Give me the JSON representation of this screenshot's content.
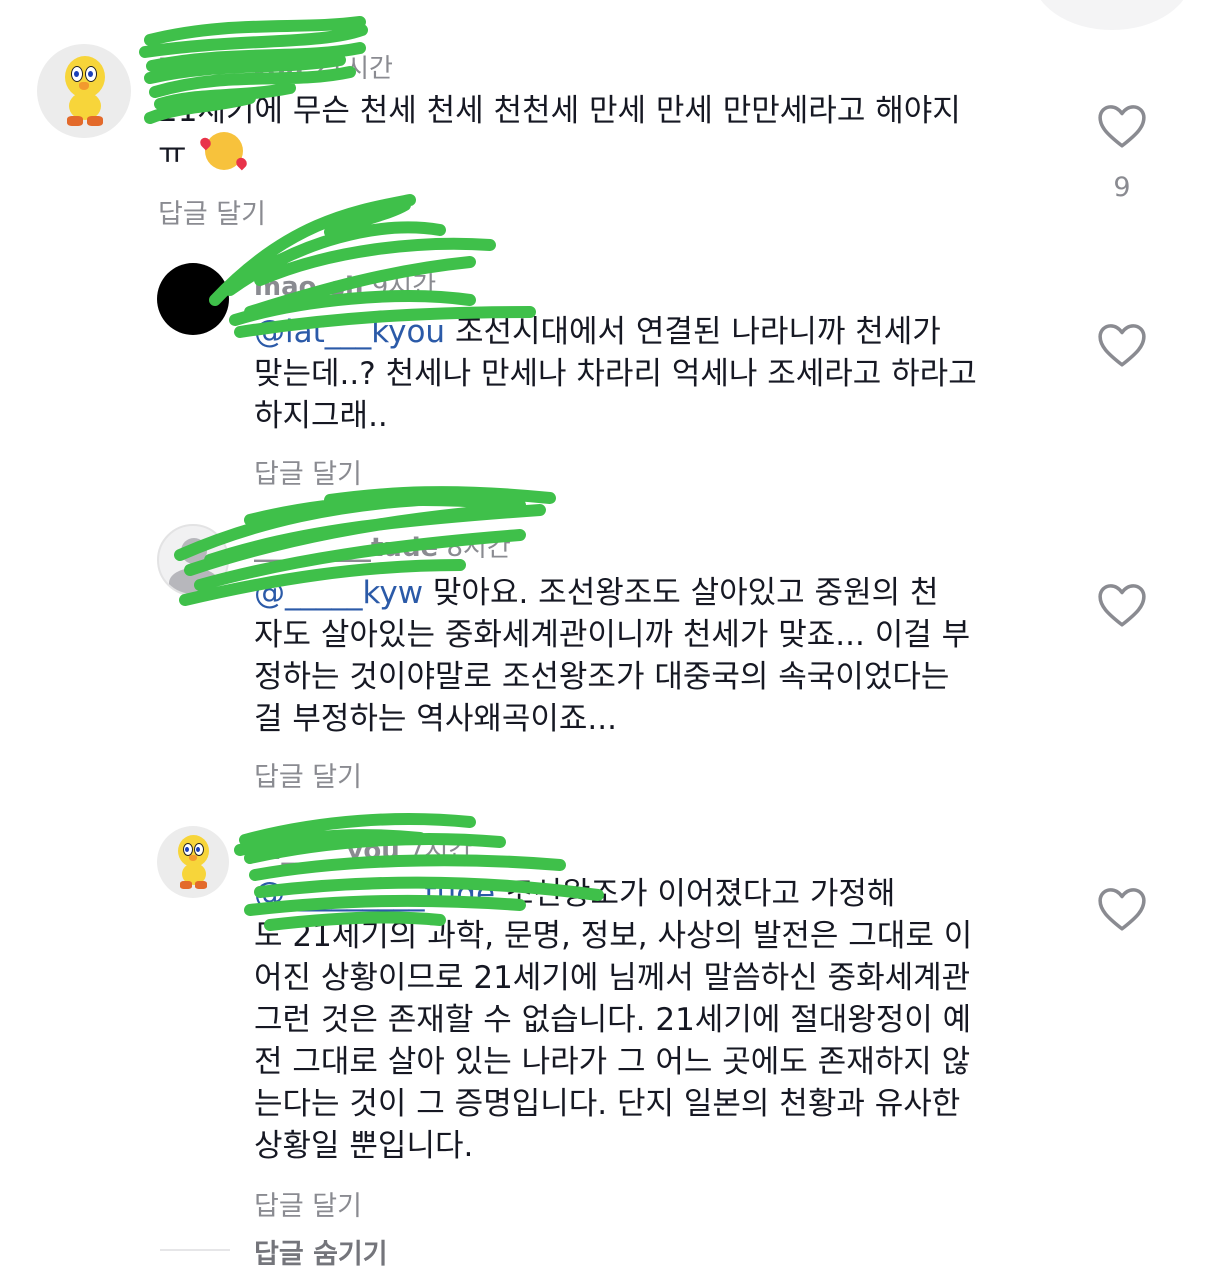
{
  "comments": [
    {
      "username": "iu_____you",
      "time": "21시간",
      "lines": [
        "21세기에 무슨 천세 천세 천천세 만세 만세 만만세라고 해야지",
        "ㅠ"
      ],
      "emoji": "smiling-face-with-hearts",
      "reply_label": "답글 달기",
      "like_count": "9"
    },
    {
      "username": "mao_sh",
      "time": "9시간",
      "mention": "@iat___kyou",
      "lines": [
        "조선시대에서 연결된 나라니까 천세가",
        "맞는데..? 천세나 만세나 차라리 억세나 조세라고 하라고",
        "하지그래.."
      ],
      "reply_label": "답글 달기"
    },
    {
      "username": "_________tude",
      "time": "8시간",
      "mention": "@_____kyw",
      "lines": [
        "맞아요. 조선왕조도 살아있고 중원의 천",
        "자도 살아있는 중화세계관이니까 천세가 맞죠... 이걸 부",
        "정하는 것이야말로 조선왕조가 대중국의 속국이었다는",
        "걸 부정하는 역사왜곡이죠..."
      ],
      "reply_label": "답글 달기"
    },
    {
      "username": "iu_____you",
      "time": "7시간",
      "mention": "@_________tude",
      "lines": [
        "조선왕조가 이어졌다고 가정해",
        "도 21세기의 과학, 문명, 정보, 사상의 발전은 그대로 이",
        "어진 상황이므로 21세기에 님께서 말씀하신 중화세계관",
        "그런 것은 존재할 수 없습니다. 21세기에 절대왕정이 예",
        "전 그대로 살아 있는 나라가 그 어느 곳에도 존재하지 않",
        "는다는 것이 그 증명입니다. 단지 일본의 천황과 유사한",
        "상황일 뿐입니다."
      ],
      "reply_label": "답글 달기"
    }
  ],
  "hide_replies_label": "답글 숨기기",
  "colors": {
    "text": "#161823",
    "secondary": "#8a8b91",
    "mention": "#2b5aa8",
    "scribble": "#3fc04a"
  }
}
